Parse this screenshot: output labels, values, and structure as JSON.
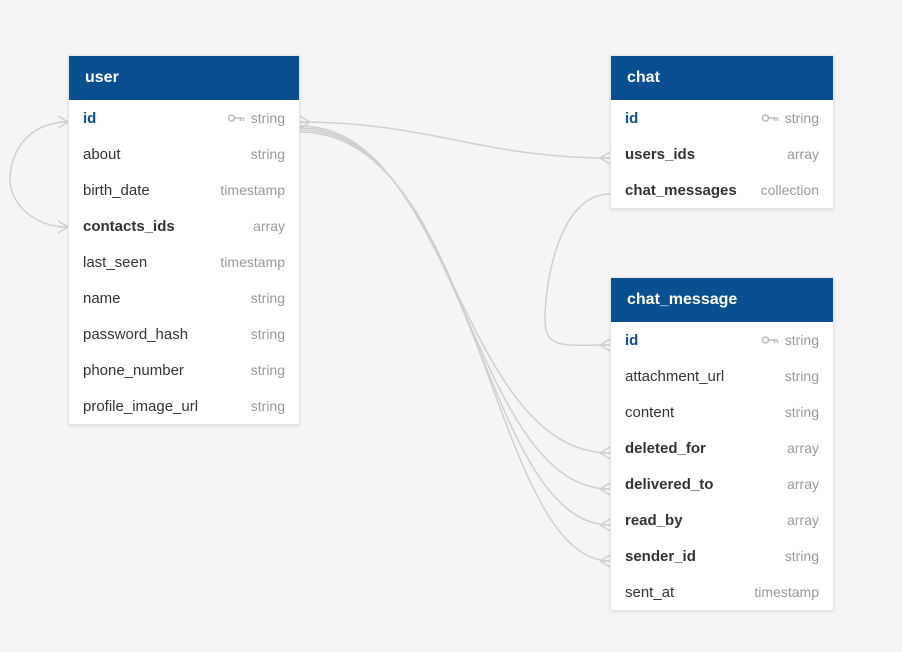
{
  "entities": {
    "user": {
      "title": "user",
      "fields": [
        {
          "name": "id",
          "type": "string",
          "pk": true,
          "bold": false
        },
        {
          "name": "about",
          "type": "string",
          "pk": false,
          "bold": false
        },
        {
          "name": "birth_date",
          "type": "timestamp",
          "pk": false,
          "bold": false
        },
        {
          "name": "contacts_ids",
          "type": "array",
          "pk": false,
          "bold": true
        },
        {
          "name": "last_seen",
          "type": "timestamp",
          "pk": false,
          "bold": false
        },
        {
          "name": "name",
          "type": "string",
          "pk": false,
          "bold": false
        },
        {
          "name": "password_hash",
          "type": "string",
          "pk": false,
          "bold": false
        },
        {
          "name": "phone_number",
          "type": "string",
          "pk": false,
          "bold": false
        },
        {
          "name": "profile_image_url",
          "type": "string",
          "pk": false,
          "bold": false
        }
      ]
    },
    "chat": {
      "title": "chat",
      "fields": [
        {
          "name": "id",
          "type": "string",
          "pk": true,
          "bold": false
        },
        {
          "name": "users_ids",
          "type": "array",
          "pk": false,
          "bold": true
        },
        {
          "name": "chat_messages",
          "type": "collection",
          "pk": false,
          "bold": true
        }
      ]
    },
    "chat_message": {
      "title": "chat_message",
      "fields": [
        {
          "name": "id",
          "type": "string",
          "pk": true,
          "bold": false
        },
        {
          "name": "attachment_url",
          "type": "string",
          "pk": false,
          "bold": false
        },
        {
          "name": "content",
          "type": "string",
          "pk": false,
          "bold": false
        },
        {
          "name": "deleted_for",
          "type": "array",
          "pk": false,
          "bold": true
        },
        {
          "name": "delivered_to",
          "type": "array",
          "pk": false,
          "bold": true
        },
        {
          "name": "read_by",
          "type": "array",
          "pk": false,
          "bold": true
        },
        {
          "name": "sender_id",
          "type": "string",
          "pk": false,
          "bold": true
        },
        {
          "name": "sent_at",
          "type": "timestamp",
          "pk": false,
          "bold": false
        }
      ]
    }
  }
}
